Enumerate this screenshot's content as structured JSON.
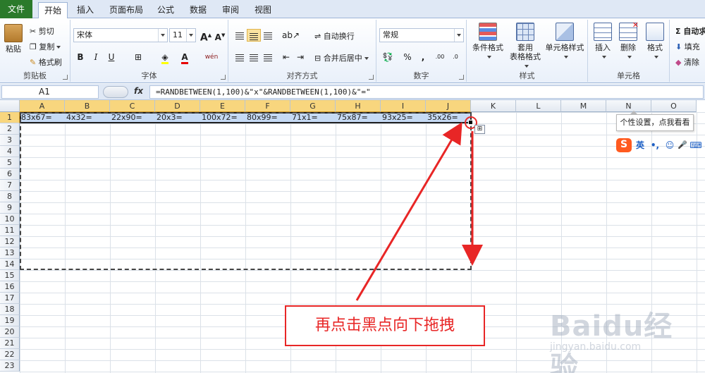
{
  "tabs": [
    "文件",
    "开始",
    "插入",
    "页面布局",
    "公式",
    "数据",
    "审阅",
    "视图"
  ],
  "ribbon": {
    "clipboard": {
      "group_label": "剪贴板",
      "paste": "粘贴",
      "cut": "剪切",
      "copy": "复制",
      "format_painter": "格式刷"
    },
    "font": {
      "group_label": "字体",
      "font_name": "宋体",
      "font_size": "11",
      "bold": "B",
      "italic": "I",
      "underline": "U",
      "increase": "A",
      "decrease": "A",
      "font_color": "A",
      "wen": "wén"
    },
    "alignment": {
      "group_label": "对齐方式",
      "wrap_text": "自动换行",
      "merge_center": "合并后居中"
    },
    "number": {
      "group_label": "数字",
      "format": "常规",
      "percent": "%",
      "comma": ",",
      "inc_decimal": ".00",
      "dec_decimal": ".0"
    },
    "styles": {
      "group_label": "样式",
      "conditional": "条件格式",
      "table_line1": "套用",
      "table_line2": "表格格式",
      "cell_styles": "单元格样式"
    },
    "cells": {
      "group_label": "单元格",
      "insert": "插入",
      "delete": "删除",
      "format": "格式"
    },
    "editing": {
      "autosum": "Σ 自动求",
      "fill": "填充",
      "clear": "清除"
    }
  },
  "formula_bar": {
    "name_box": "A1",
    "fx": "fx",
    "formula": "=RANDBETWEEN(1,100)&\"x\"&RANDBETWEEN(1,100)&\"=\""
  },
  "columns": [
    "A",
    "B",
    "C",
    "D",
    "E",
    "F",
    "G",
    "H",
    "I",
    "J",
    "K",
    "L",
    "M",
    "N",
    "O"
  ],
  "rows": [
    "1",
    "2",
    "3",
    "4",
    "5",
    "6",
    "7",
    "8",
    "9",
    "10",
    "11",
    "12",
    "13",
    "14",
    "15",
    "16",
    "17",
    "18",
    "19",
    "20",
    "21",
    "22",
    "23"
  ],
  "row1_values": [
    "83x67=",
    "4x32=",
    "22x90=",
    "20x3=",
    "100x72=",
    "80x99=",
    "71x1=",
    "75x87=",
    "93x25=",
    "35x26="
  ],
  "tooltip": "个性设置，点我看看",
  "ime": {
    "logo": "S",
    "lang": "英",
    "punct": "•,",
    "emoji": "☺",
    "mic": "🎤",
    "kbd": "⌨"
  },
  "callout": "再点击黑点向下拖拽",
  "watermark": {
    "logo": "Baidu经验",
    "url": "jingyan.baidu.com"
  },
  "colors": {
    "file_tab": "#2b7a2b",
    "selection": "#c6daf4",
    "header_sel": "#f8d67e",
    "annotation": "#e82626"
  }
}
